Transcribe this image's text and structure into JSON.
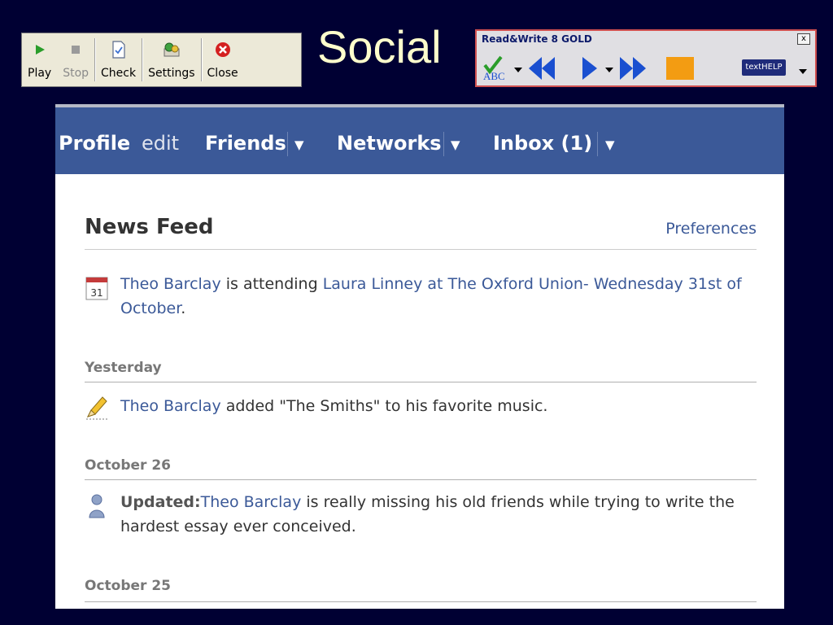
{
  "toolbar": {
    "buttons": [
      {
        "label": "Play",
        "icon": "play-icon",
        "enabled": true
      },
      {
        "label": "Stop",
        "icon": "stop-icon",
        "enabled": false
      },
      {
        "label": "Check",
        "icon": "check-document-icon",
        "enabled": true
      },
      {
        "label": "Settings",
        "icon": "settings-icon",
        "enabled": true
      },
      {
        "label": "Close",
        "icon": "close-icon",
        "enabled": true
      }
    ],
    "colors": {
      "play": "#2a9d2a",
      "close": "#d42020"
    }
  },
  "slide_title": "Social",
  "readwrite": {
    "title": "Read&Write 8 GOLD",
    "close_label": "x",
    "spell_text": "ABC",
    "logo_text": "textHELP",
    "colors": {
      "arrows": "#1a4fd0",
      "orange": "#f39c12",
      "check": "#2a9d2a"
    }
  },
  "nav": {
    "profile": "Profile",
    "edit": "edit",
    "friends": "Friends",
    "networks": "Networks",
    "inbox": "Inbox (1)",
    "arrow": "▼",
    "bg_color": "#3b5998"
  },
  "feed": {
    "title": "News Feed",
    "preferences": "Preferences",
    "entries": [
      {
        "icon": "calendar-icon",
        "calendar_day": "31",
        "actor": "Theo Barclay",
        "text": " is attending ",
        "target": "Laura Linney at The Oxford Union- Wednesday 31st of October",
        "suffix": "."
      },
      {
        "group": "Yesterday",
        "icon": "pencil-icon",
        "actor": "Theo Barclay",
        "text": " added \"The Smiths\" to his favorite music."
      },
      {
        "group": "October 26",
        "icon": "person-icon",
        "label": "Updated:",
        "actor": "Theo Barclay",
        "text": " is really missing his old friends while trying to write the hardest essay ever conceived."
      },
      {
        "group": "October 25"
      }
    ]
  }
}
